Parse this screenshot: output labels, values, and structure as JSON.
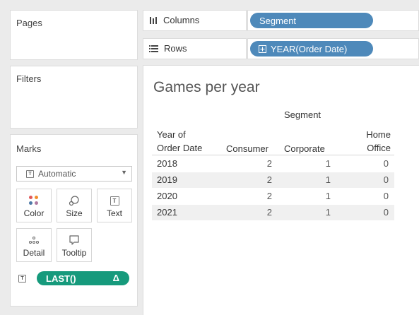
{
  "cards": {
    "pages": "Pages",
    "filters": "Filters",
    "marks": "Marks"
  },
  "marks": {
    "mark_type": "Automatic",
    "buttons": [
      {
        "label": "Color",
        "icon": "color-dots-icon"
      },
      {
        "label": "Size",
        "icon": "size-icon"
      },
      {
        "label": "Text",
        "icon": "text-icon"
      },
      {
        "label": "Detail",
        "icon": "detail-icon"
      },
      {
        "label": "Tooltip",
        "icon": "tooltip-icon"
      }
    ],
    "field_pill": "LAST()",
    "field_pill_delta": "Δ"
  },
  "shelves": {
    "columns_label": "Columns",
    "columns_pill": "Segment",
    "rows_label": "Rows",
    "rows_pill": "YEAR(Order Date)"
  },
  "view": {
    "title": "Games per year",
    "segment_header": "Segment",
    "row_header_line1": "Year of",
    "row_header_line2": "Order Date",
    "columns": [
      "Consumer",
      "Corporate",
      "Home",
      "Office"
    ],
    "rows": [
      {
        "year": "2018",
        "consumer": "2",
        "corporate": "1",
        "home_office": "0"
      },
      {
        "year": "2019",
        "consumer": "2",
        "corporate": "1",
        "home_office": "0"
      },
      {
        "year": "2020",
        "consumer": "2",
        "corporate": "1",
        "home_office": "0"
      },
      {
        "year": "2021",
        "consumer": "2",
        "corporate": "1",
        "home_office": "0"
      }
    ]
  },
  "colors": {
    "pill_blue": "#4e89ba",
    "pill_green": "#169a7c",
    "shade": "#f0f0f0"
  }
}
